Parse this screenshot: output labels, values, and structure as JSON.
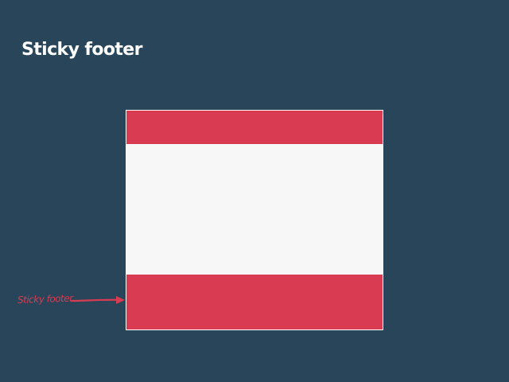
{
  "slide": {
    "title": "Sticky footer"
  },
  "diagram": {
    "annotation": "Sticky footer",
    "regions": [
      "header",
      "content",
      "footer"
    ]
  },
  "colors": {
    "background": "#284559",
    "accent": "#d93c52",
    "content": "#f7f7f7",
    "border": "#ffffff"
  }
}
